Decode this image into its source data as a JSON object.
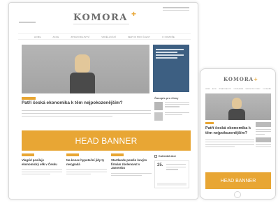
{
  "desktop": {
    "logo": "KOMORA",
    "nav": [
      "",
      "HOME",
      "AKCE",
      "ZPRAVODAJSTVÍ",
      "VZDĚLÁVÁNÍ",
      "SERVIS PRO ČLENY",
      "O KOMOŘE",
      ""
    ],
    "main_title": "Patří česká ekonomika k těm nejpokozenějším?",
    "sidebar_title": "Časopis pro členy",
    "head_banner": "HEAD BANNER",
    "articles": [
      {
        "title": "Vlagrid posiluje ekonomický věk v Česku"
      },
      {
        "title": "Na konec hypoteční jídy ty nevypadá"
      },
      {
        "title": "Startlande poměn kovým firmám zkolenovat v Janovsku"
      }
    ],
    "calendar_title": "Kalendář akcí",
    "calendar_day": "25."
  },
  "tablet": {
    "logo": "KOMORA",
    "title": "Patří česká ekonomika k těm nejpokozenějším?",
    "head_banner": "HEAD BANNER"
  },
  "colors": {
    "accent": "#e8a634",
    "hero": "#a8a8a8",
    "ad": "#3d5f82"
  },
  "icons": [
    "calendar-icon",
    "home-button-icon"
  ]
}
